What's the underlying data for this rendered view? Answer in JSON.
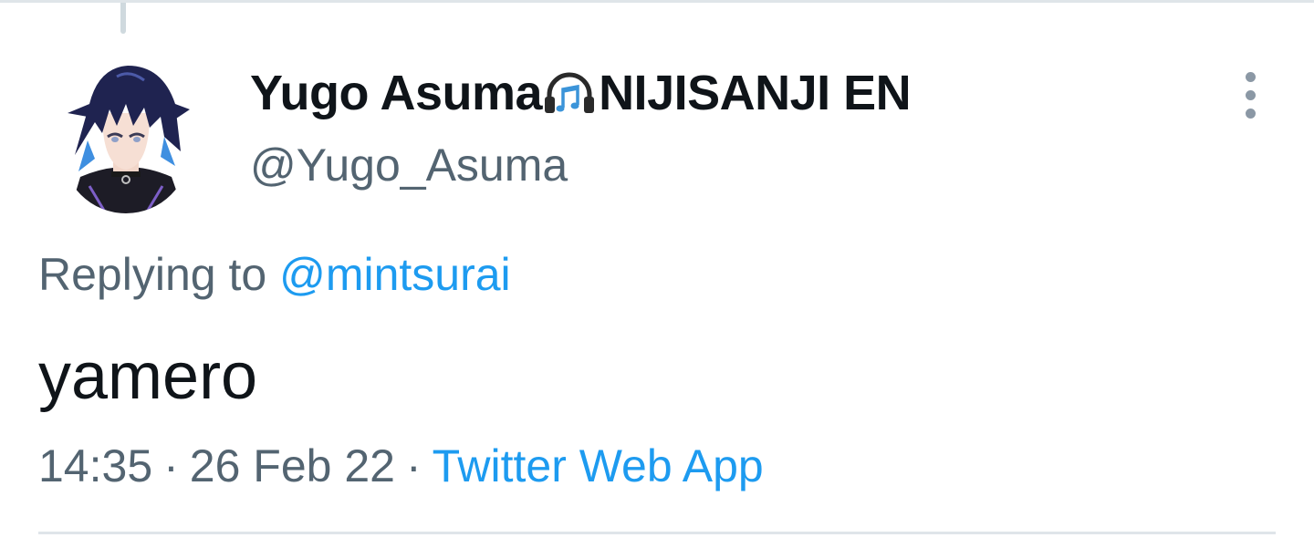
{
  "tweet": {
    "author": {
      "display_name_part1": "Yugo Asuma",
      "display_name_part2": "NIJISANJI EN",
      "name_emoji_icon": "headphones-music-icon",
      "handle": "@Yugo_Asuma",
      "avatar": "avatar-anime-character"
    },
    "reply": {
      "prefix": "Replying to",
      "mention": "@mintsurai"
    },
    "text": "yamero",
    "meta": {
      "time": "14:35",
      "separator": "·",
      "date": "26 Feb 22",
      "source": "Twitter Web App"
    },
    "more_icon": "more-vertical-icon"
  },
  "colors": {
    "text_primary": "#0f1419",
    "text_secondary": "#536471",
    "link": "#1d9bf0",
    "divider": "#dfe5e9"
  }
}
